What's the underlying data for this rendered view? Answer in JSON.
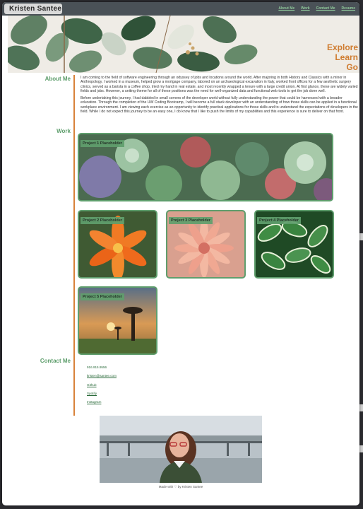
{
  "nav": {
    "brand": "Kristen Santee",
    "links": [
      "About Me",
      "Work",
      "Contact Me",
      "Resume"
    ]
  },
  "hero": {
    "tagline": [
      "Explore",
      "Learn",
      "Go"
    ]
  },
  "sections": {
    "about": "About Me",
    "work": "Work",
    "contact": "Contact Me"
  },
  "about": {
    "paragraphs": [
      "I am coming to the field of software engineering through an odyssey of jobs and locations around the world. After majoring in both History and Classics with a minor in Anthropology, I worked in a museum, helped grow a mortgage company, labored on an archaeological excavation in Italy, worked front offices for a few aesthetic surgery clinics, served as a barista in a coffee shop, tried my hand in real estate, and most recently wrapped a tenure with a large credit union. At first glance, these are widely varied fields and jobs. However, a uniting theme for all of these positions was the need for well-organized data and functional web tools to get the job done well.",
      "Before undertaking this journey, I had dabbled in small corners of the developer world without fully understanding the power that could be harnessed with a broader education. Through the completion of the UW Coding Bootcamp, I will become a full stack developer with an understanding of how those skills can be applied in a functional workplace environment. I am viewing each exercise as an opportunity to identify practical applications for those skills and to understand the expectations of developers in the field. While I do not expect this journey to be an easy one, I do know that I like to push the limits of my capabilities and this experience is sure to deliver on that front."
    ]
  },
  "projects": [
    "Project 1 Placeholder",
    "Project 2 Placeholder",
    "Project 3 Placeholder",
    "Project 4 Placeholder",
    "Project 5 Placeholder"
  ],
  "contact": {
    "phone": "916.915.9556",
    "email": "kristen@santee.com",
    "links": [
      "Github",
      "Spotify",
      "Instagram"
    ]
  },
  "footer": {
    "text": "Made with ♡ by Kristen Santee"
  },
  "colors": {
    "accent_green": "#5f9e6d",
    "accent_orange": "#cf7c30",
    "nav_bg": "#4a5157"
  }
}
